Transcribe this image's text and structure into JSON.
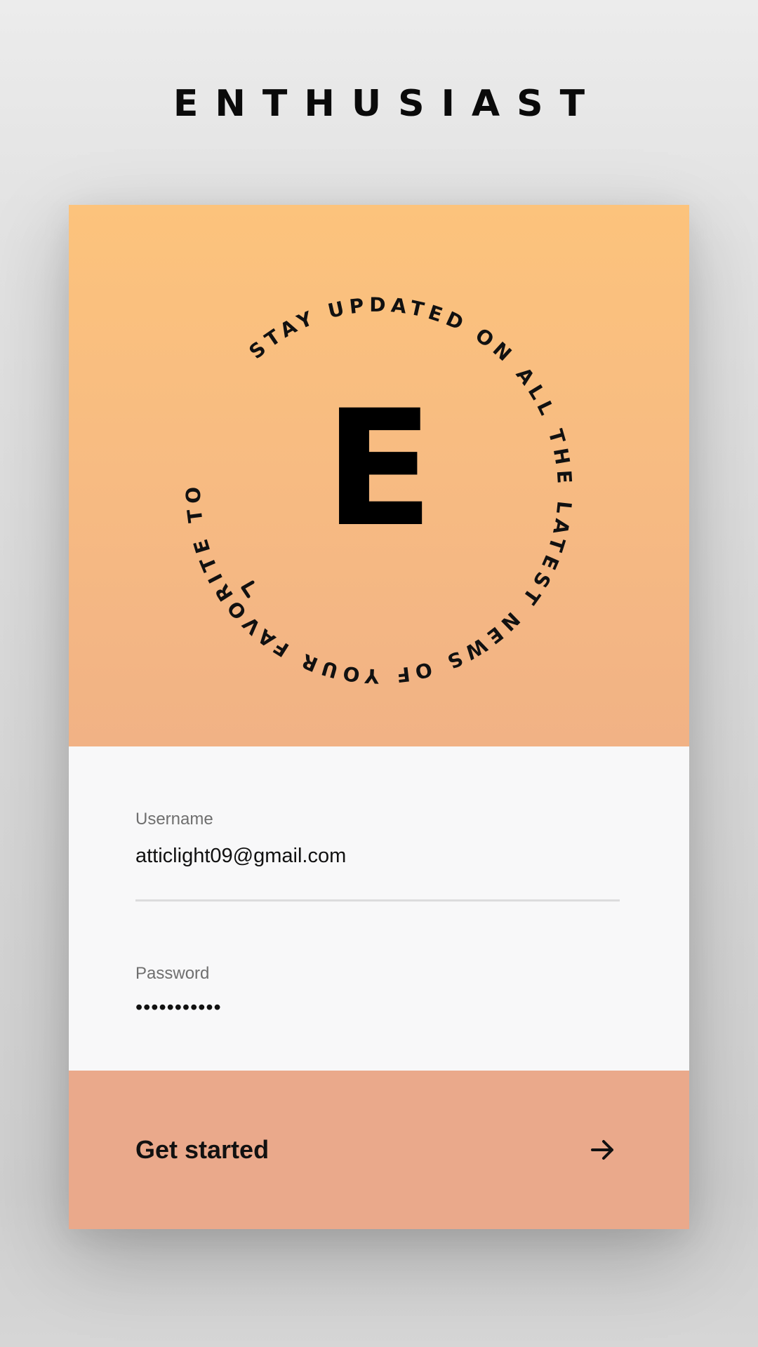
{
  "app": {
    "brand": "ENTHUSIAST",
    "badge_letter": "E",
    "badge_tagline": "STAY UPDATED ON ALL THE LATEST NEWS OF YOUR FAVORITE TOPICS"
  },
  "form": {
    "username_label": "Username",
    "username_value": "atticlight09@gmail.com",
    "password_label": "Password",
    "password_value": "•••••••••••"
  },
  "cta": {
    "label": "Get started",
    "icon": "arrow-right-icon"
  },
  "colors": {
    "hero_top": "#fcc37c",
    "hero_bottom": "#f1b285",
    "cta": "#eaa98b",
    "background": "#ebebeb"
  }
}
